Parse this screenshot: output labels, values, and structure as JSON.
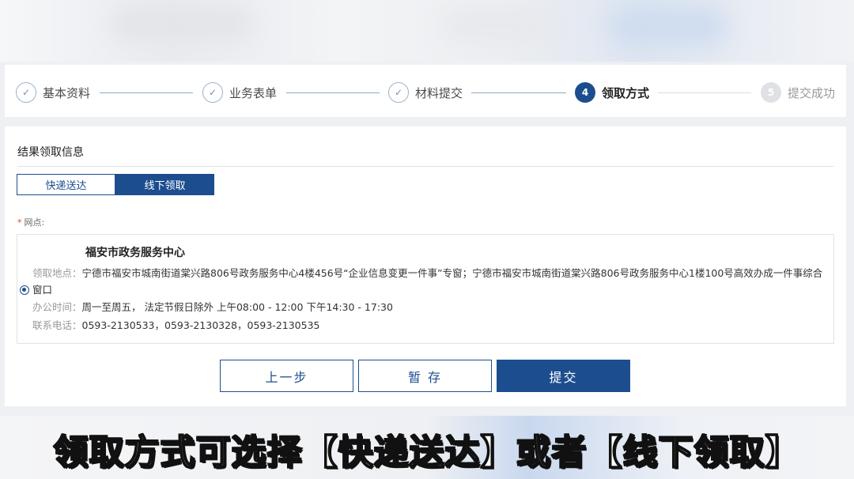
{
  "steps": [
    {
      "label": "基本资料",
      "state": "done",
      "marker": "✓"
    },
    {
      "label": "业务表单",
      "state": "done",
      "marker": "✓"
    },
    {
      "label": "材料提交",
      "state": "done",
      "marker": "✓"
    },
    {
      "label": "领取方式",
      "state": "active",
      "marker": "4"
    },
    {
      "label": "提交成功",
      "state": "todo",
      "marker": "5"
    }
  ],
  "section": {
    "title": "结果领取信息"
  },
  "tabs": {
    "express": "快递送达",
    "offline": "线下领取",
    "selected": "线下领取"
  },
  "field": {
    "required_mark": "*",
    "label": "网点:"
  },
  "option": {
    "name": "福安市政务服务中心",
    "address_key": "领取地点：",
    "address_value": "宁德市福安市城南街道棠兴路806号政务服务中心4楼456号“企业信息变更一件事”专窗；宁德市福安市城南街道棠兴路806号政务服务中心1楼100号高效办成一件事综合窗口",
    "hours_key": "办公时间：",
    "hours_value": "周一至周五， 法定节假日除外 上午08:00 - 12:00 下午14:30 - 17:30",
    "phone_key": "联系电话：",
    "phone_value": "0593-2130533，0593-2130328，0593-2130535",
    "selected": true
  },
  "buttons": {
    "prev": "上一步",
    "save": "暂 存",
    "submit": "提交"
  },
  "caption": "领取方式可选择【快递送达】或者【线下领取】",
  "colors": {
    "primary": "#1c4e8f",
    "required": "#e03a3a"
  }
}
